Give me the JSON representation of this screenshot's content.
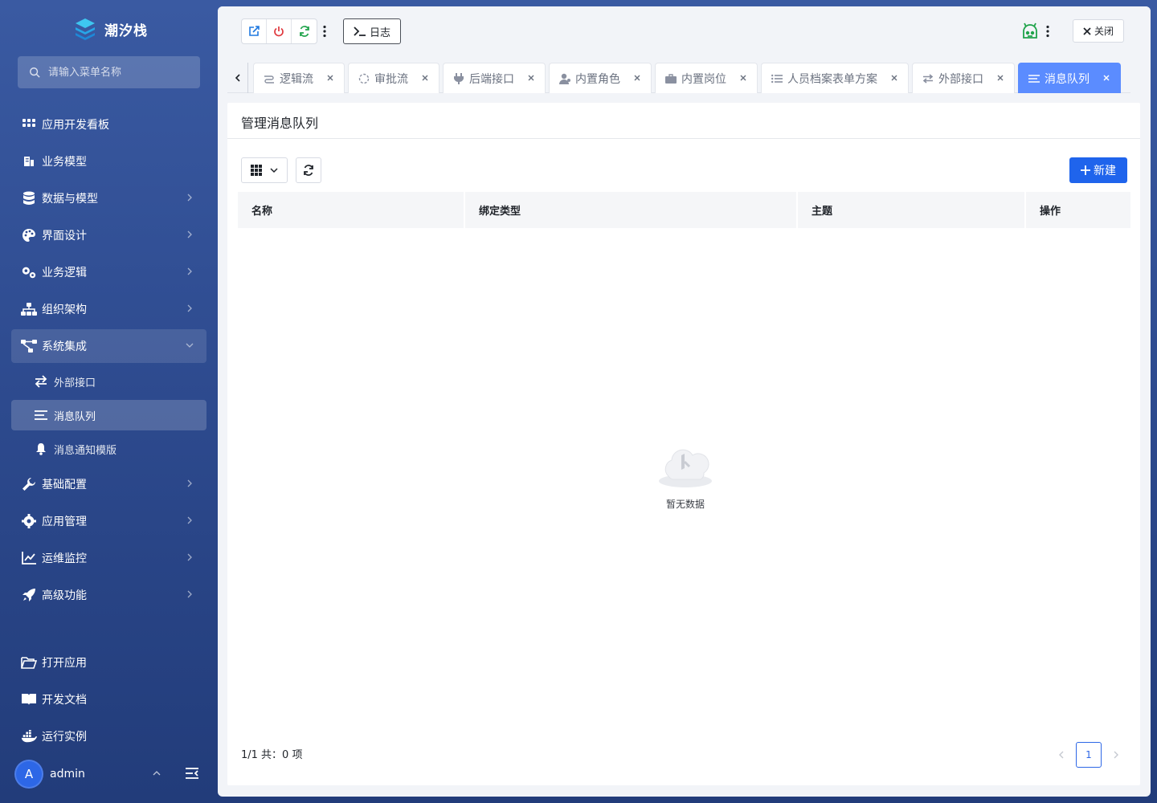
{
  "app": {
    "title": "潮汐栈"
  },
  "search": {
    "placeholder": "请输入菜单名称"
  },
  "sidebar": {
    "items": [
      {
        "label": "应用开发看板",
        "icon": "grid-icon",
        "expandable": false
      },
      {
        "label": "业务模型",
        "icon": "building-icon",
        "expandable": false
      },
      {
        "label": "数据与模型",
        "icon": "database-icon",
        "expandable": true
      },
      {
        "label": "界面设计",
        "icon": "palette-icon",
        "expandable": true
      },
      {
        "label": "业务逻辑",
        "icon": "gears-icon",
        "expandable": true
      },
      {
        "label": "组织架构",
        "icon": "org-chart-icon",
        "expandable": true
      },
      {
        "label": "系统集成",
        "icon": "share-nodes-icon",
        "expandable": true,
        "open": true
      }
    ],
    "subitems": [
      {
        "label": "外部接口",
        "icon": "swap-icon"
      },
      {
        "label": "消息队列",
        "icon": "list-icon",
        "active": true
      },
      {
        "label": "消息通知模版",
        "icon": "bell-icon"
      }
    ],
    "items2": [
      {
        "label": "基础配置",
        "icon": "wrench-icon"
      },
      {
        "label": "应用管理",
        "icon": "cog-icon"
      },
      {
        "label": "运维监控",
        "icon": "chart-line-icon"
      },
      {
        "label": "高级功能",
        "icon": "rocket-icon"
      }
    ],
    "bottom": [
      {
        "label": "打开应用",
        "icon": "folder-open-icon"
      },
      {
        "label": "开发文档",
        "icon": "book-icon"
      },
      {
        "label": "运行实例",
        "icon": "docker-icon"
      }
    ]
  },
  "user": {
    "avatar_letter": "A",
    "name": "admin"
  },
  "toolbar": {
    "log_label": "日志",
    "close_label": "关闭"
  },
  "tabs": [
    {
      "label": "逻辑流",
      "icon": "flow-icon"
    },
    {
      "label": "审批流",
      "icon": "circle-dashed-icon"
    },
    {
      "label": "后端接口",
      "icon": "plug-icon"
    },
    {
      "label": "内置角色",
      "icon": "user-icon"
    },
    {
      "label": "内置岗位",
      "icon": "briefcase-icon"
    },
    {
      "label": "人员档案表单方案",
      "icon": "list-ul-icon"
    },
    {
      "label": "外部接口",
      "icon": "swap-icon"
    },
    {
      "label": "消息队列",
      "icon": "list-icon",
      "active": true
    }
  ],
  "panel": {
    "title": "管理消息队列",
    "new_label": "新建",
    "columns": [
      "名称",
      "绑定类型",
      "主题",
      "操作"
    ],
    "empty_text": "暂无数据",
    "footer": "1/1 共：0 项",
    "current_page": "1"
  },
  "colors": {
    "accent": "#1f64ec",
    "tab_active": "#5b8cff",
    "sidebar_bg": "#2d4a8e"
  }
}
